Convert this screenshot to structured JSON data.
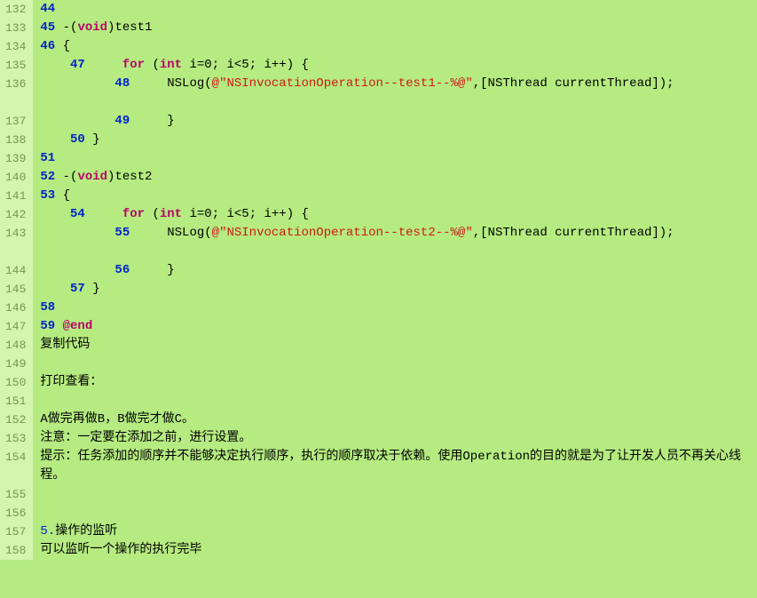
{
  "gutter": [
    "132",
    "133",
    "134",
    "135",
    "136",
    "137",
    "138",
    "139",
    "140",
    "141",
    "142",
    "143",
    "144",
    "145",
    "146",
    "147",
    "148",
    "149",
    "150",
    "151",
    "152",
    "153",
    "154",
    "155",
    "156",
    "157",
    "158"
  ],
  "code": {
    "lineNums": {
      "n44": "44",
      "n45": "45",
      "n46": "46",
      "n47": "47",
      "n48": "48",
      "n49": "49",
      "n50": "50",
      "n51": "51",
      "n52": "52",
      "n53": "53",
      "n54": "54",
      "n55": "55",
      "n56": "56",
      "n57": "57",
      "n58": "58",
      "n59": "59"
    },
    "tokens": {
      "dash_open": " -(",
      "void": "void",
      "close_paren_test1": ")test1",
      "close_paren_test2": ")test2",
      "open_brace": " {",
      "for_kw": "for",
      "space_paren": " (",
      "int_kw": "int",
      "loop_rest": " i=0; i<5; i++) {",
      "nslog": "NSLog(",
      "at": "@",
      "str1": "\"NSInvocationOperation--test1--%@\"",
      "str2": "\"NSInvocationOperation--test2--%@\"",
      "after_str": ",[NSThread currentThread]);",
      "close_brace": "}",
      "end": "@end",
      "copy_code": "复制代码",
      "print_view": "打印查看：",
      "seq_text": "A做完再做B，B做完才做C。",
      "note_text": "注意：一定要在添加之前，进行设置。",
      "tip_text": "提示：任务添加的顺序并不能够决定执行顺序，执行的顺序取决于依赖。使用Operation的目的就是为了让开发人员不再关心线程。",
      "section5": "5.",
      "section5_title": "操作的监听",
      "section5_desc": "可以监听一个操作的执行完毕"
    }
  }
}
